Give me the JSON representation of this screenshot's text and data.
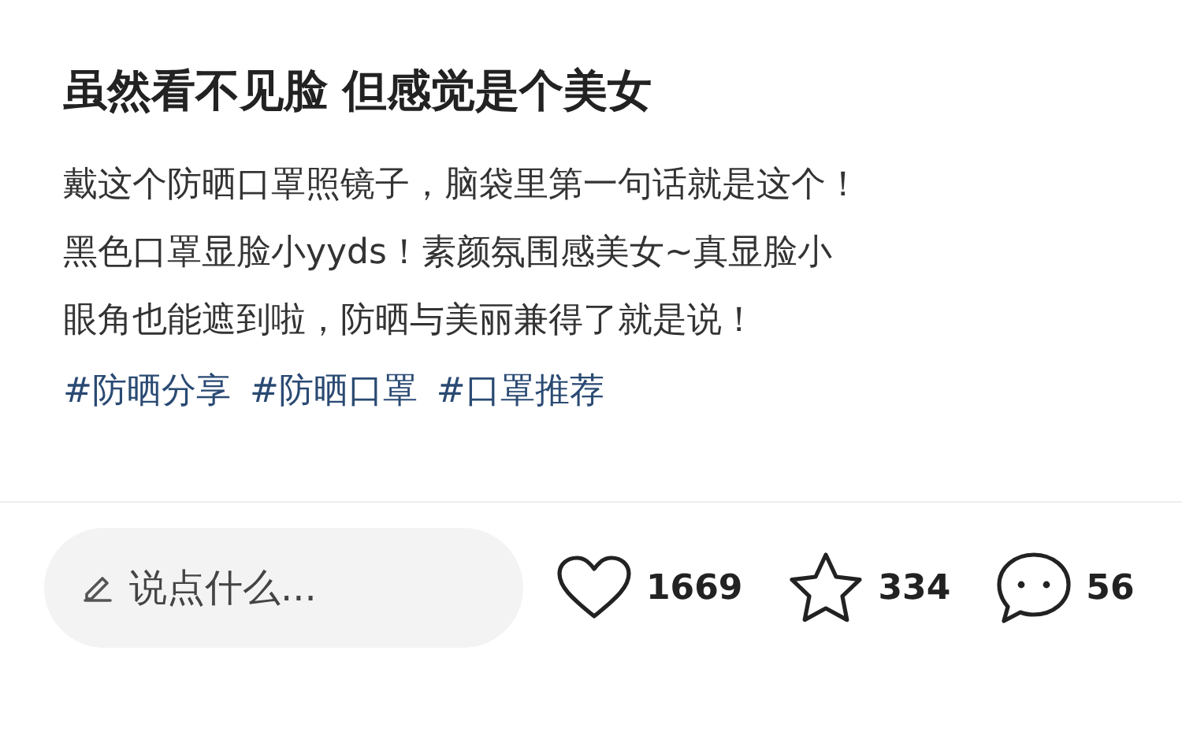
{
  "post": {
    "title": "虽然看不见脸 但感觉是个美女",
    "body": [
      "戴这个防晒口罩照镜子，脑袋里第一句话就是这个！",
      "黑色口罩显脸小yyds！素颜氛围感美女~真显脸小",
      "眼角也能遮到啦，防晒与美丽兼得了就是说！"
    ],
    "tags": [
      "#防晒分享",
      "#防晒口罩",
      "#口罩推荐"
    ]
  },
  "comment_field": {
    "placeholder": "说点什么..."
  },
  "actions": [
    {
      "kind": "like",
      "count": "1669"
    },
    {
      "kind": "favorite",
      "count": "334"
    },
    {
      "kind": "comment",
      "count": "56"
    }
  ]
}
